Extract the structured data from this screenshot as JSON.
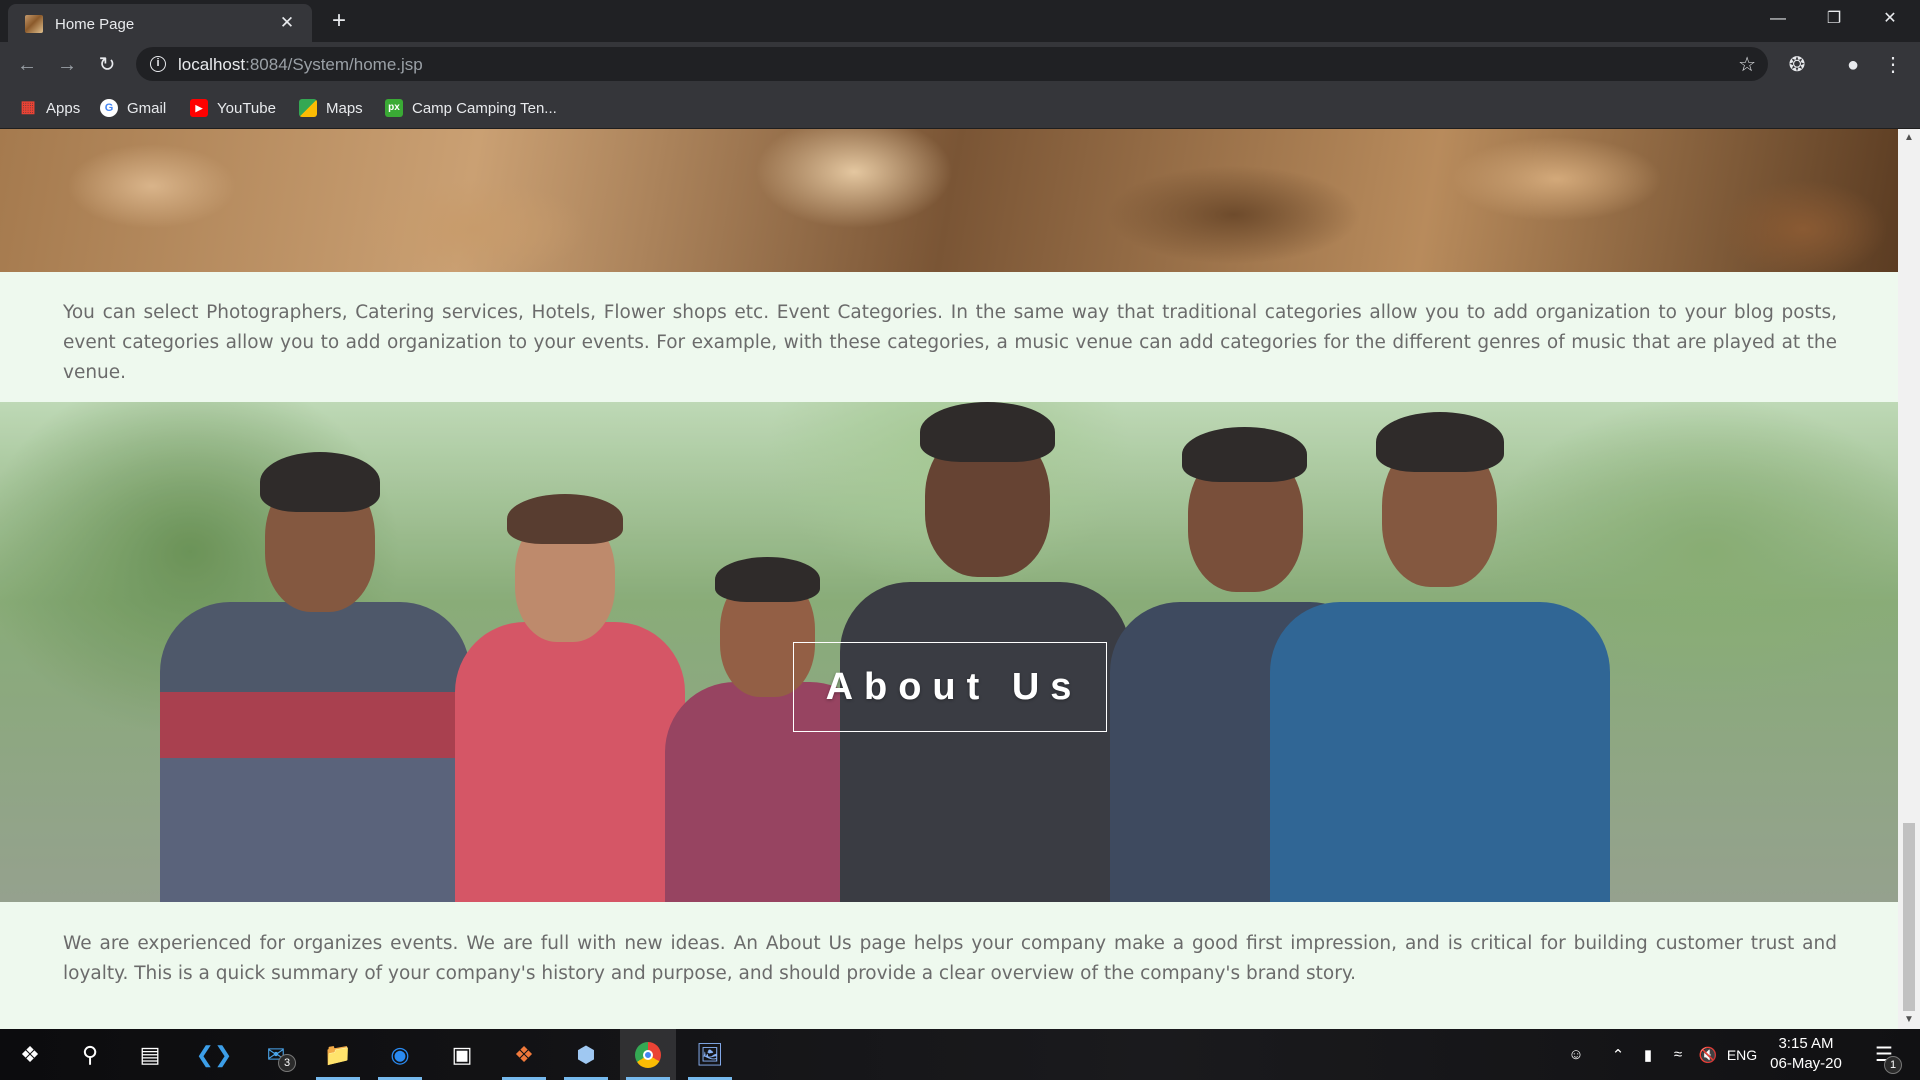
{
  "browser": {
    "tab_title": "Home Page",
    "tab_close": "✕",
    "new_tab": "+",
    "window_controls": {
      "minimize": "—",
      "restore": "❐",
      "close": "✕"
    },
    "url_host": "localhost",
    "url_path": ":8084/System/home.jsp",
    "bookmarks": [
      {
        "label": "Apps",
        "icon": "apps-grid-icon",
        "color": "#ea4335"
      },
      {
        "label": "Gmail",
        "icon": "google-icon",
        "color": "#4285f4"
      },
      {
        "label": "YouTube",
        "icon": "youtube-icon",
        "color": "#ff0000"
      },
      {
        "label": "Maps",
        "icon": "maps-icon",
        "color": "#34a853"
      },
      {
        "label": "Camp Camping Ten...",
        "icon": "px-icon",
        "color": "#3aaa35"
      }
    ]
  },
  "page": {
    "categories_text": "You can select Photographers, Catering services, Hotels, Flower shops etc. Event Categories. In the same way that traditional categories allow you to add organization to your blog posts, event categories allow you to add organization to your events. For example, with these categories, a music venue can add categories for the different genres of music that are played at the venue.",
    "about_heading": "About Us",
    "about_text": "We are experienced for organizes events. We are full with new ideas. An About Us page helps your company make a good first impression, and is critical for building customer trust and loyalty. This is a quick summary of your company's history and purpose, and should provide a clear overview of the company's brand story.",
    "background_color": "#eef9ee",
    "text_color": "#6b6b6b"
  },
  "taskbar": {
    "mail_badge": "3",
    "language": "ENG",
    "time": "3:15 AM",
    "date": "06-May-20",
    "notification_badge": "1"
  }
}
